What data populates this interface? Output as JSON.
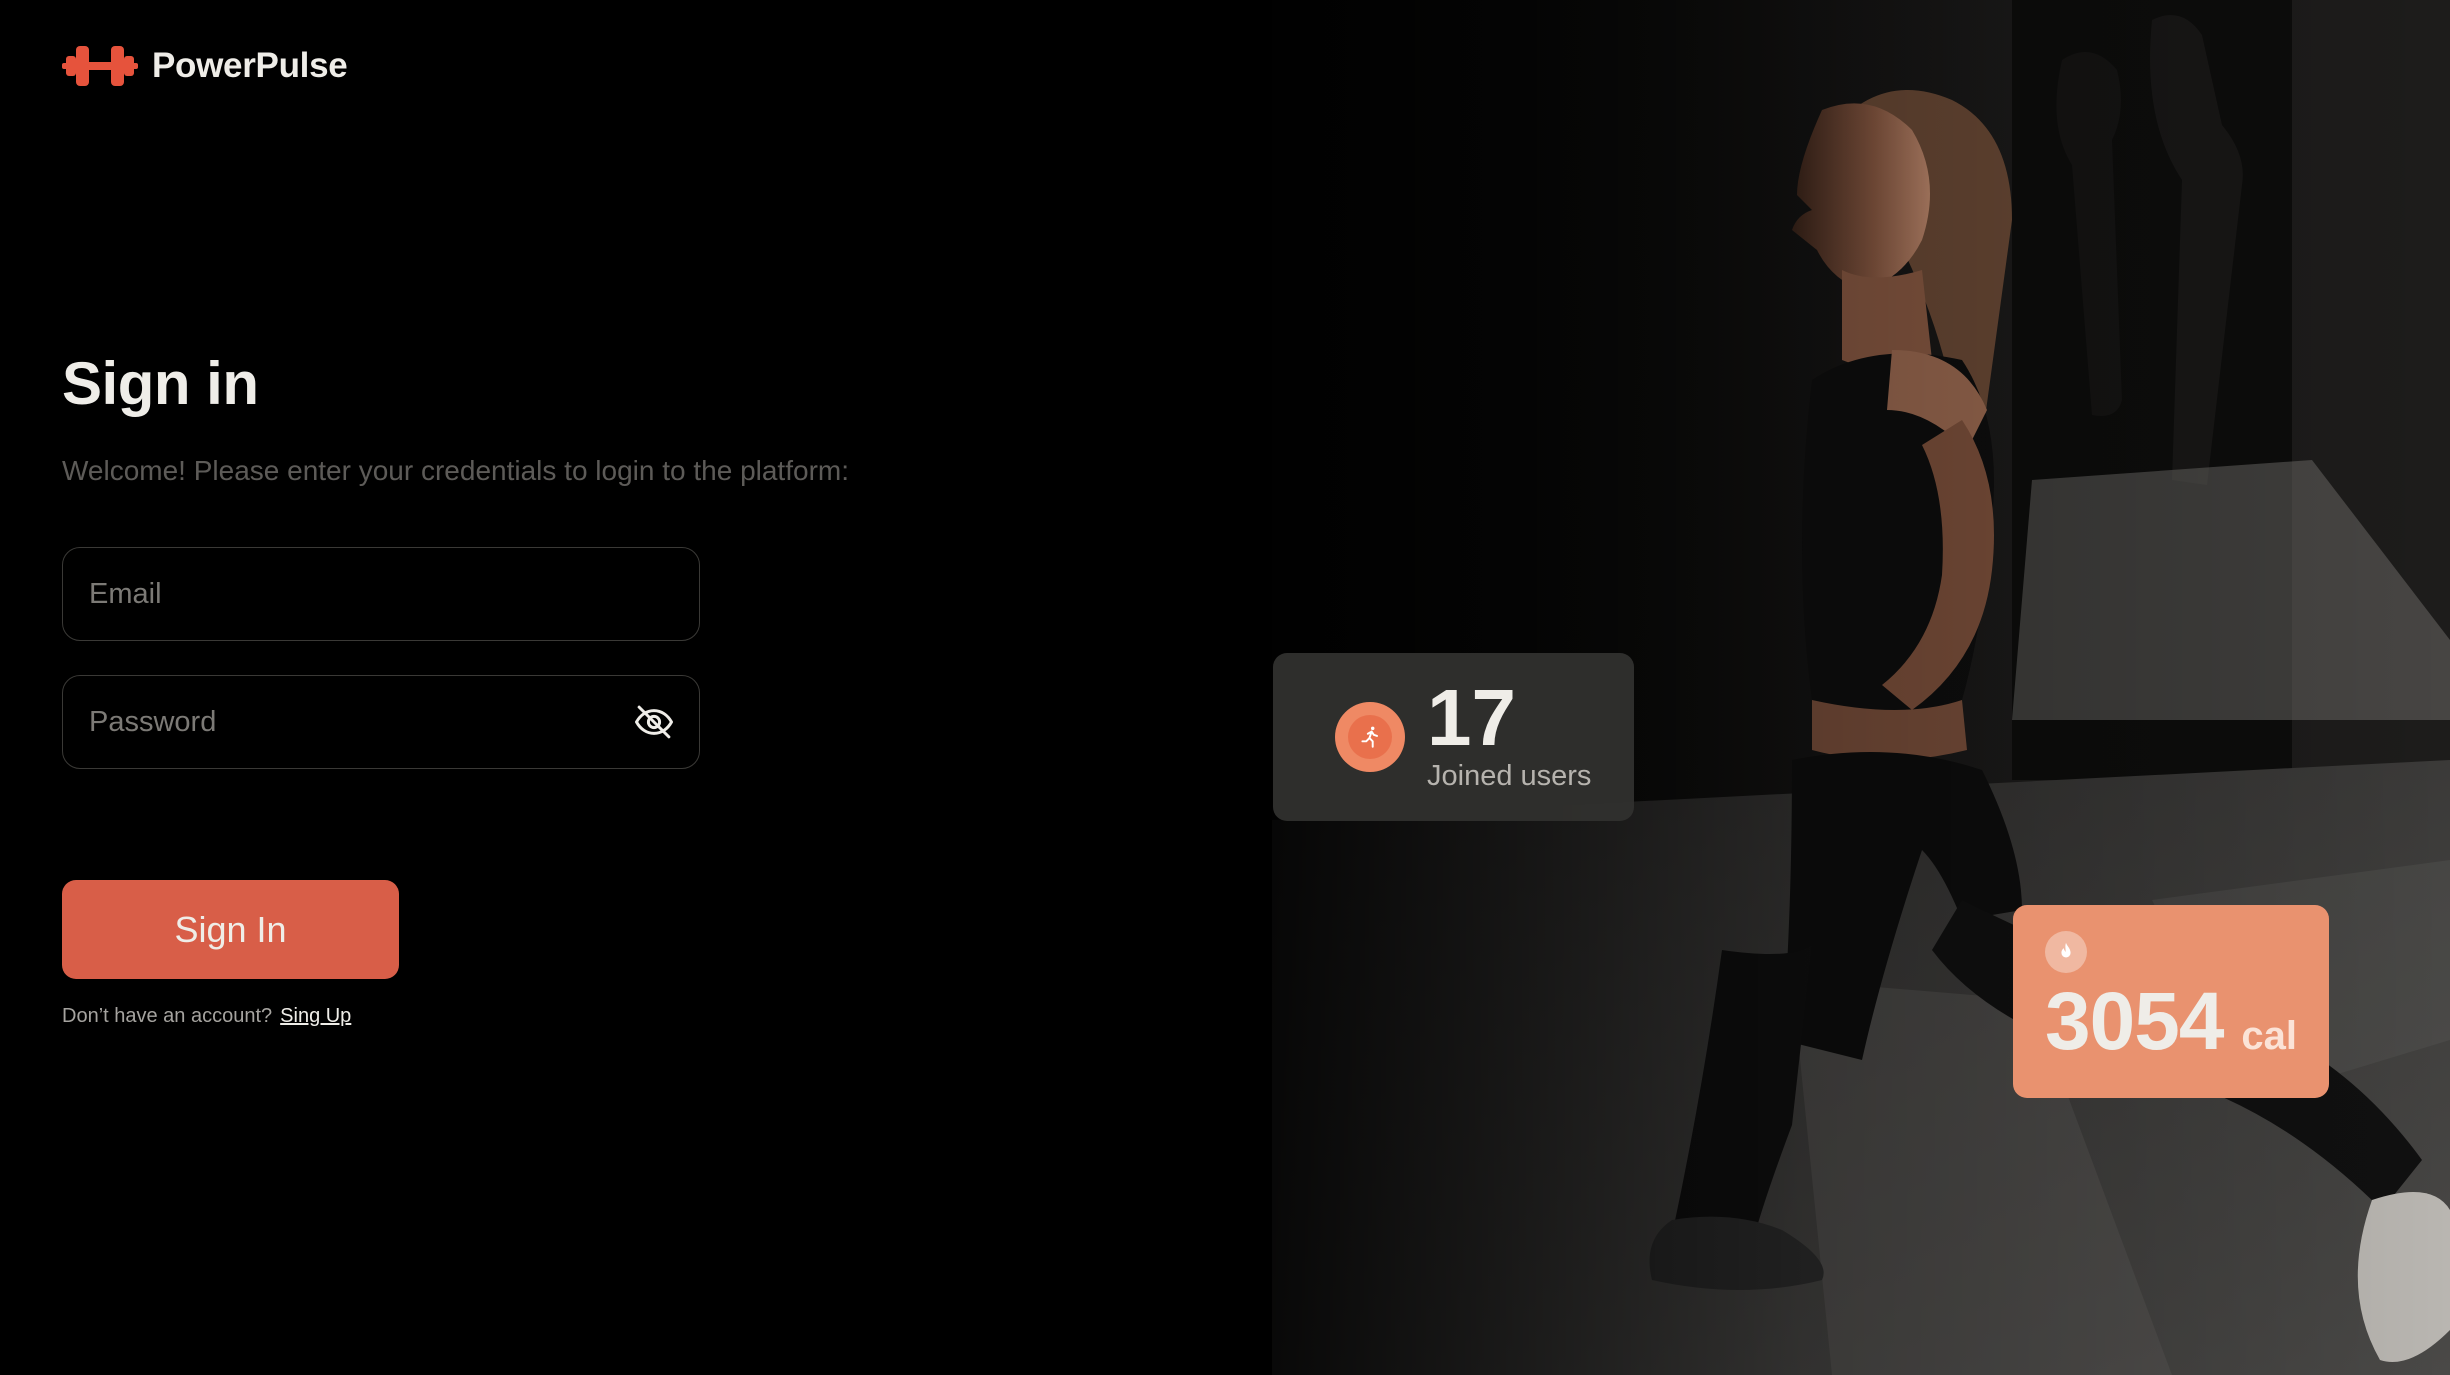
{
  "brand": {
    "name": "PowerPulse",
    "accent_color": "#d85e48",
    "logo_icon": "dumbbell-icon"
  },
  "signin": {
    "title": "Sign in",
    "subtitle": "Welcome! Please enter your credentials to login to the platform:",
    "email_placeholder": "Email",
    "password_placeholder": "Password",
    "password_toggle_icon": "eye-off-icon",
    "button_label": "Sign In",
    "signup_question": "Don’t have an account?",
    "signup_link": "Sing Up"
  },
  "stats": {
    "users": {
      "count": "17",
      "label": "Joined users",
      "icon": "running-person-icon"
    },
    "calories": {
      "value": "3054",
      "unit": "cal",
      "icon": "flame-icon"
    }
  }
}
